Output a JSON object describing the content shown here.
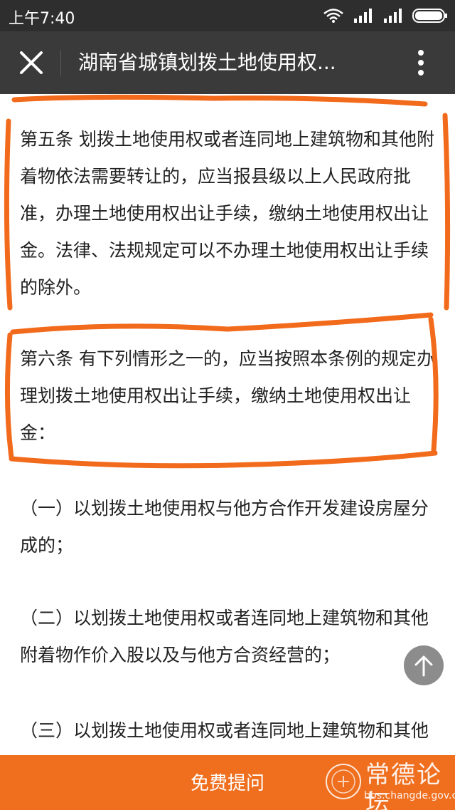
{
  "status_bar": {
    "time": "上午7:40"
  },
  "header": {
    "title": "湖南省城镇划拨土地使用权..."
  },
  "content": {
    "paragraphs": [
      "第五条 划拨土地使用权或者连同地上建筑物和其他附着物依法需要转让的，应当报县级以上人民政府批准，办理土地使用权出让手续，缴纳土地使用权出让金。法律、法规规定可以不办理土地使用权出让手续的除外。",
      "第六条 有下列情形之一的，应当按照本条例的规定办理划拨土地使用权出让手续，缴纳土地使用权出让金：",
      "（一）以划拨土地使用权与他方合作开发建设房屋分成的；",
      "（二）以划拨土地使用权或者连同地上建筑物和其他附着物作价入股以及与他方合资经营的；",
      "（三）以划拨土地使用权或者连同地上建筑物和其他附着物出租的；"
    ]
  },
  "bottom_bar": {
    "ask_label": "免费提问",
    "watermark_name": "常德论坛",
    "watermark_url": "bbs.changde.gov.cn"
  },
  "colors": {
    "status_bar_bg": "#2e2e2e",
    "title_bar_bg": "#3a3a3a",
    "accent_orange": "#ef6f1f",
    "annotation_orange": "#f26a1b"
  },
  "icons": [
    "wifi-icon",
    "signal-icon",
    "battery-icon",
    "close-icon",
    "more-vertical-icon",
    "arrow-up-icon"
  ]
}
